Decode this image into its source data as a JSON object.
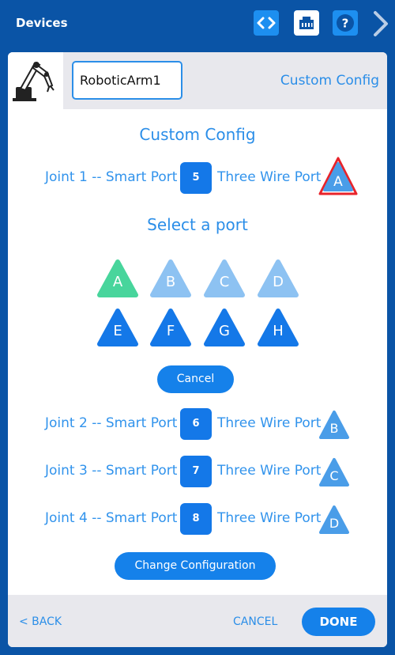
{
  "header": {
    "title": "Devices",
    "icons": [
      "code-icon",
      "port-icon",
      "help-icon",
      "chevron-right-icon"
    ]
  },
  "device": {
    "name_value": "RoboticArm1",
    "config_link": "Custom Config",
    "icon": "robotic-arm-icon"
  },
  "main": {
    "heading": "Custom Config",
    "select_heading": "Select a port",
    "cancel_label": "Cancel",
    "change_label": "Change Configuration"
  },
  "joints": [
    {
      "label": "Joint 1 -- Smart Port",
      "smart_port": "5",
      "three_wire_label": "Three Wire Port",
      "three_wire_port": "A"
    },
    {
      "label": "Joint 2 -- Smart Port",
      "smart_port": "6",
      "three_wire_label": "Three Wire Port",
      "three_wire_port": "B"
    },
    {
      "label": "Joint 3 -- Smart Port",
      "smart_port": "7",
      "three_wire_label": "Three Wire Port",
      "three_wire_port": "C"
    },
    {
      "label": "Joint 4 -- Smart Port",
      "smart_port": "8",
      "three_wire_label": "Three Wire Port",
      "three_wire_port": "D"
    }
  ],
  "ports": [
    {
      "label": "A",
      "state": "selected"
    },
    {
      "label": "B",
      "state": "unavailable"
    },
    {
      "label": "C",
      "state": "unavailable"
    },
    {
      "label": "D",
      "state": "unavailable"
    },
    {
      "label": "E",
      "state": "available"
    },
    {
      "label": "F",
      "state": "available"
    },
    {
      "label": "G",
      "state": "available"
    },
    {
      "label": "H",
      "state": "available"
    }
  ],
  "footer": {
    "back_label": "< BACK",
    "cancel_label": "CANCEL",
    "done_label": "DONE"
  },
  "colors": {
    "header_bg": "#0a54a6",
    "accent": "#2b8ee8",
    "selected_port": "#48d59c",
    "available_port": "#1478e8",
    "unavailable_port": "#8dc2f2",
    "highlight_outline": "#e8232a"
  }
}
